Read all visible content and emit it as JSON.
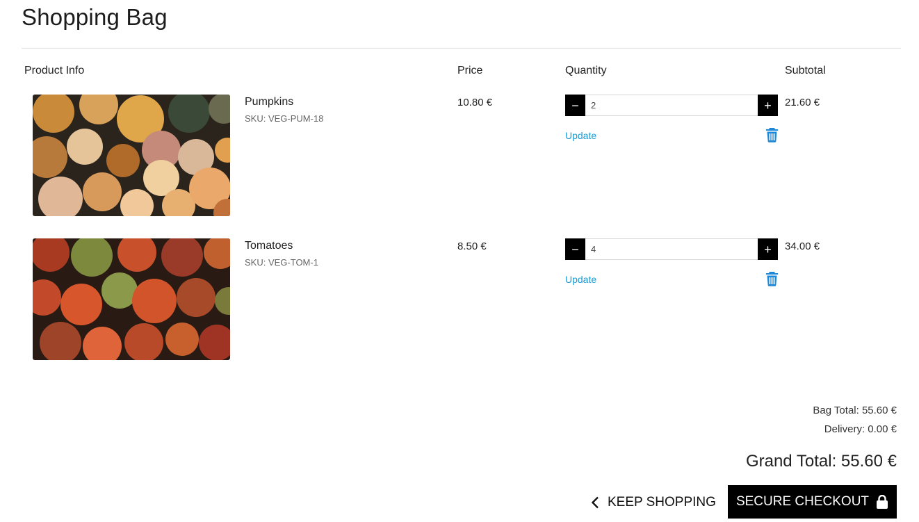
{
  "page": {
    "title": "Shopping Bag"
  },
  "table": {
    "headers": {
      "product": "Product Info",
      "price": "Price",
      "quantity": "Quantity",
      "subtotal": "Subtotal"
    }
  },
  "items": [
    {
      "name": "Pumpkins",
      "sku": "SKU: VEG-PUM-18",
      "price": "10.80 €",
      "quantity": "2",
      "subtotal": "21.60 €",
      "update_label": "Update",
      "decrement": "−",
      "increment": "+",
      "image": "pumpkins-photo"
    },
    {
      "name": "Tomatoes",
      "sku": "SKU: VEG-TOM-1",
      "price": "8.50 €",
      "quantity": "4",
      "subtotal": "34.00 €",
      "update_label": "Update",
      "decrement": "−",
      "increment": "+",
      "image": "tomatoes-photo"
    }
  ],
  "summary": {
    "bag_total": "Bag Total: 55.60 €",
    "delivery": "Delivery: 0.00 €",
    "grand_total": "Grand Total: 55.60 €"
  },
  "actions": {
    "keep_shopping": "KEEP SHOPPING",
    "checkout": "SECURE CHECKOUT"
  },
  "icons": {
    "remove": "trash-icon",
    "back": "chevron-left-icon",
    "checkout": "lock-icon"
  },
  "colors": {
    "accent": "#1d9bd1",
    "button": "#000000"
  }
}
